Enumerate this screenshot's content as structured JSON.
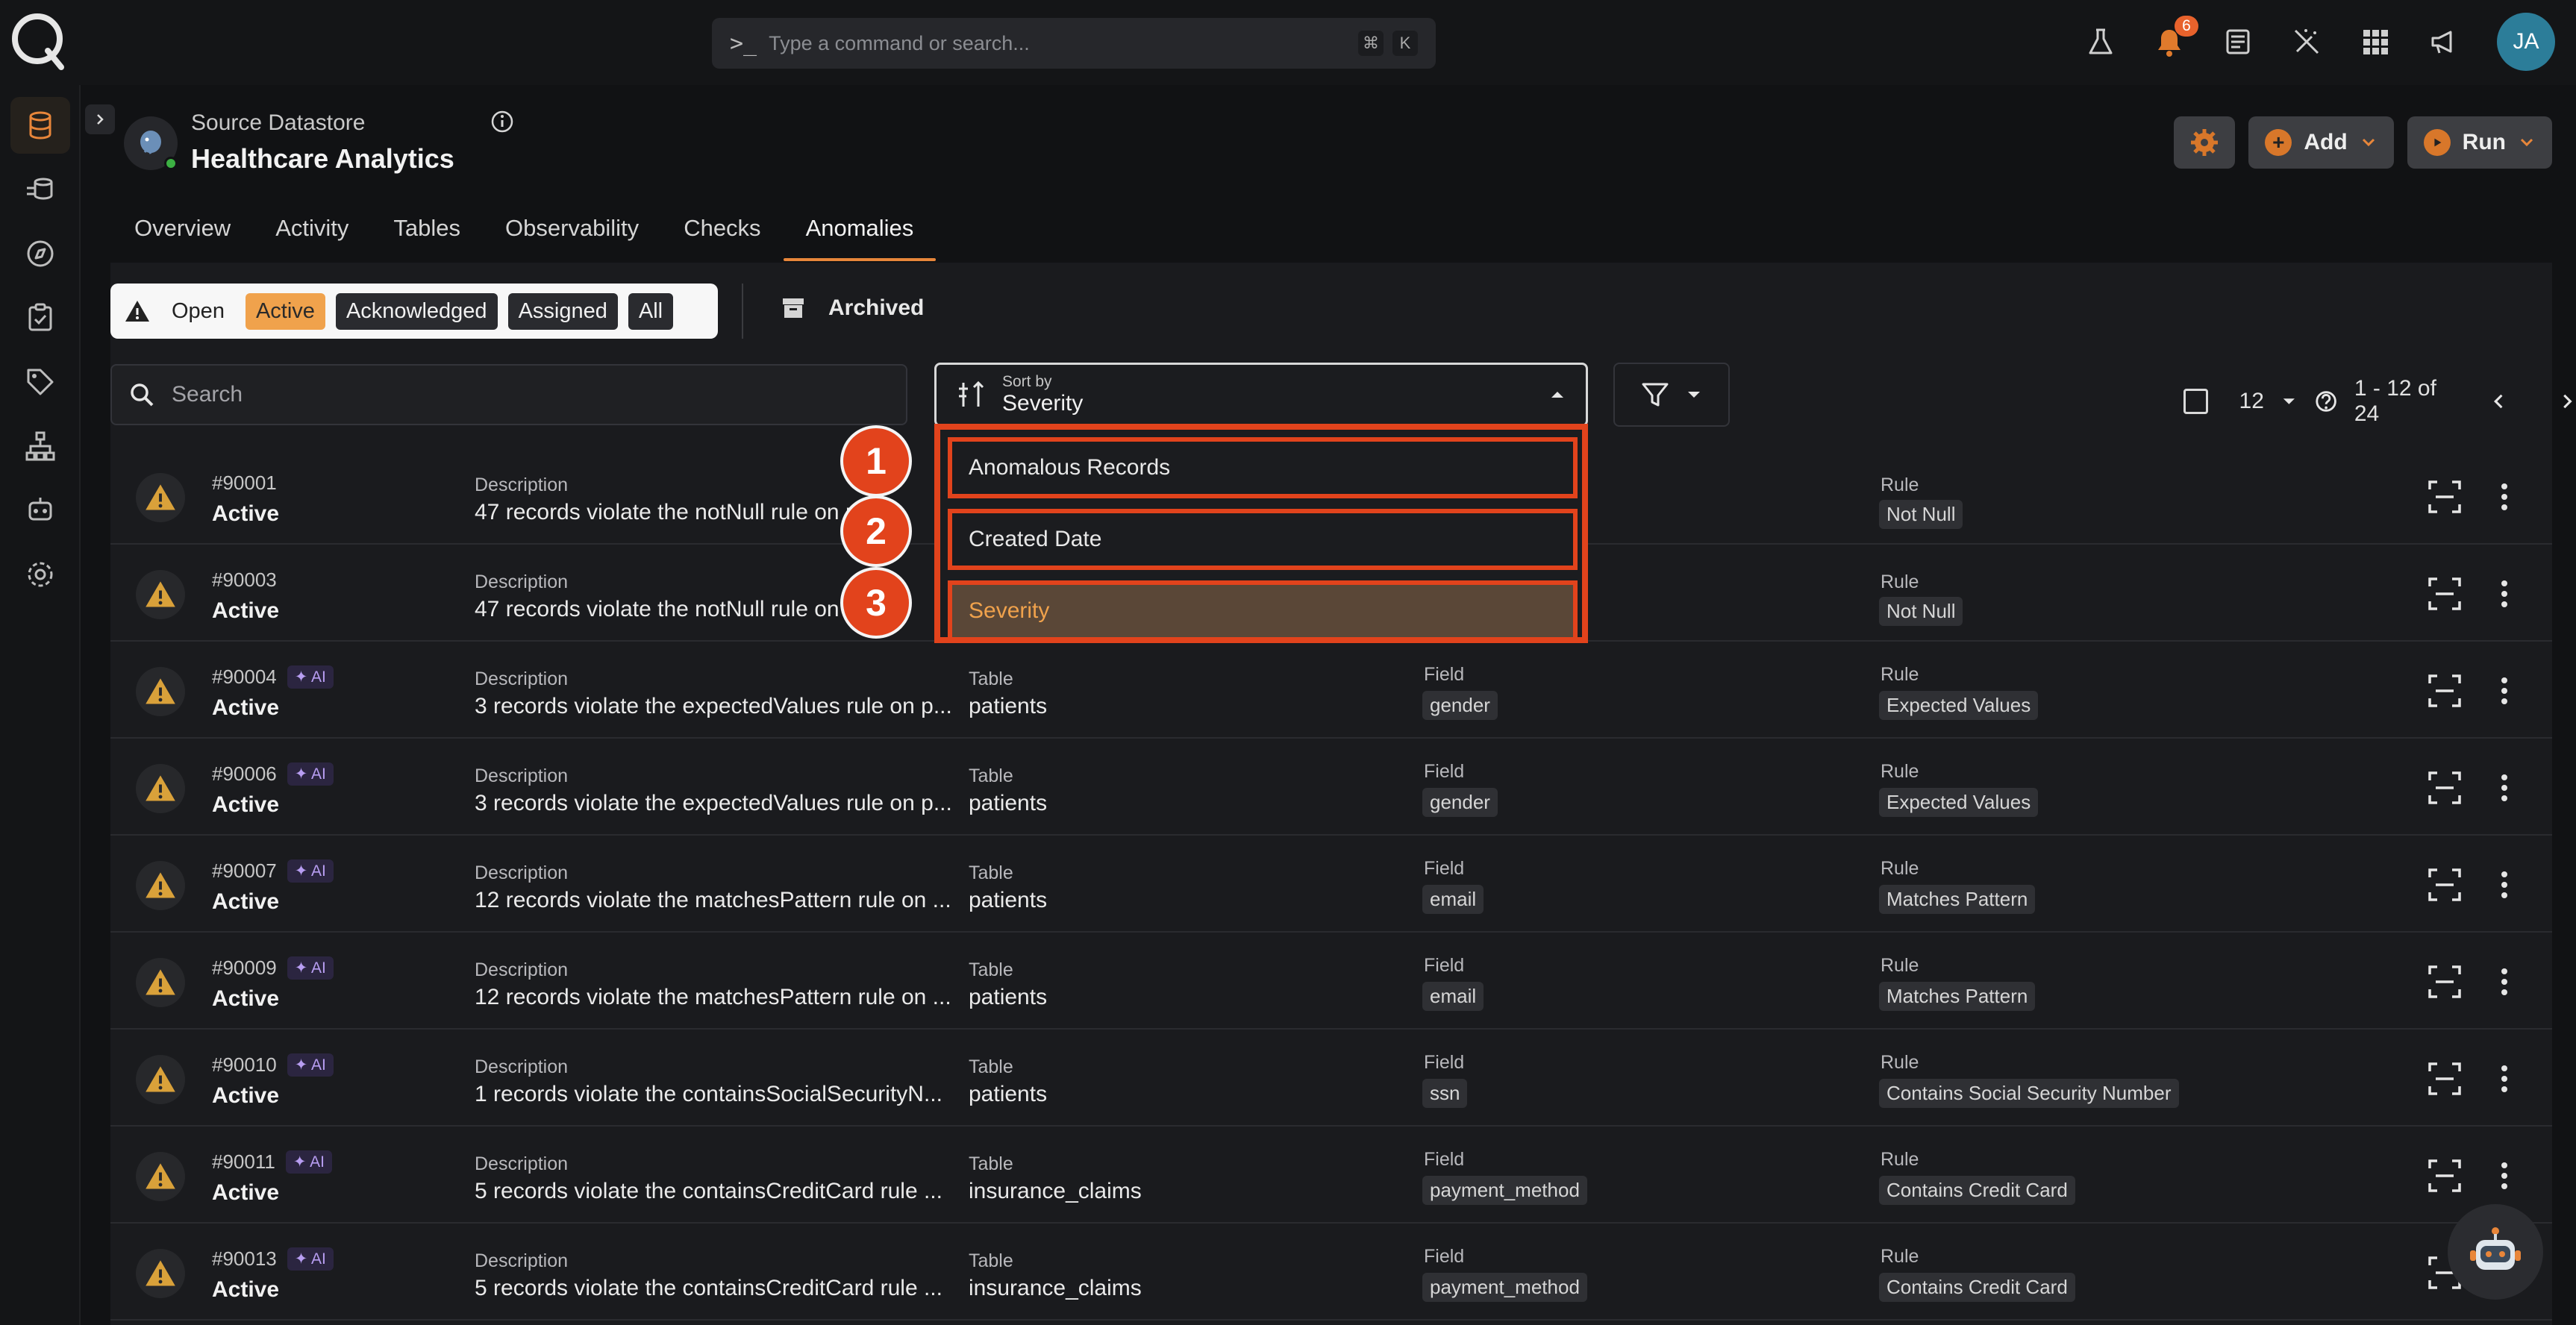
{
  "command_bar": {
    "prompt": ">_",
    "placeholder": "Type a command or search...",
    "key1": "⌘",
    "key2": "K"
  },
  "notifications": {
    "count": "6"
  },
  "user": {
    "initials": "JA"
  },
  "datastore": {
    "label": "Source Datastore",
    "name": "Healthcare Analytics"
  },
  "header_buttons": {
    "add": "Add",
    "run": "Run"
  },
  "tabs": [
    "Overview",
    "Activity",
    "Tables",
    "Observability",
    "Checks",
    "Anomalies"
  ],
  "status_filter": {
    "open": "Open",
    "active": "Active",
    "acknowledged": "Acknowledged",
    "assigned": "Assigned",
    "all": "All",
    "archived": "Archived"
  },
  "search": {
    "placeholder": "Search"
  },
  "sort": {
    "label": "Sort by",
    "value": "Severity"
  },
  "pagination": {
    "page_size": "12",
    "range": "1 - 12 of 24"
  },
  "sort_menu": {
    "items": [
      "Anomalous Records",
      "Created Date",
      "Severity"
    ],
    "selected": "Severity",
    "markers": [
      "1",
      "2",
      "3"
    ]
  },
  "column_labels": {
    "description": "Description",
    "table": "Table",
    "field": "Field",
    "rule": "Rule"
  },
  "ai_label": "✦ AI",
  "rows": [
    {
      "id": "#90001",
      "status": "Active",
      "ai": false,
      "description": "47 records violate the notNull rule on pa",
      "table": "",
      "field": "",
      "rule": "Not Null"
    },
    {
      "id": "#90003",
      "status": "Active",
      "ai": false,
      "description": "47 records violate the notNull rule on pa",
      "table": "",
      "field": "",
      "rule": "Not Null"
    },
    {
      "id": "#90004",
      "status": "Active",
      "ai": true,
      "description": "3 records violate the expectedValues rule on p...",
      "table": "patients",
      "field": "gender",
      "rule": "Expected Values"
    },
    {
      "id": "#90006",
      "status": "Active",
      "ai": true,
      "description": "3 records violate the expectedValues rule on p...",
      "table": "patients",
      "field": "gender",
      "rule": "Expected Values"
    },
    {
      "id": "#90007",
      "status": "Active",
      "ai": true,
      "description": "12 records violate the matchesPattern rule on ...",
      "table": "patients",
      "field": "email",
      "rule": "Matches Pattern"
    },
    {
      "id": "#90009",
      "status": "Active",
      "ai": true,
      "description": "12 records violate the matchesPattern rule on ...",
      "table": "patients",
      "field": "email",
      "rule": "Matches Pattern"
    },
    {
      "id": "#90010",
      "status": "Active",
      "ai": true,
      "description": "1 records violate the containsSocialSecurityN...",
      "table": "patients",
      "field": "ssn",
      "rule": "Contains Social Security Number"
    },
    {
      "id": "#90011",
      "status": "Active",
      "ai": true,
      "description": "5 records violate the containsCreditCard rule ...",
      "table": "insurance_claims",
      "field": "payment_method",
      "rule": "Contains Credit Card"
    },
    {
      "id": "#90013",
      "status": "Active",
      "ai": true,
      "description": "5 records violate the containsCreditCard rule ...",
      "table": "insurance_claims",
      "field": "payment_method",
      "rule": "Contains Credit Card"
    }
  ],
  "colors": {
    "accent": "#e8863a",
    "annotation": "#e2431c",
    "warning": "#d9a13a"
  }
}
